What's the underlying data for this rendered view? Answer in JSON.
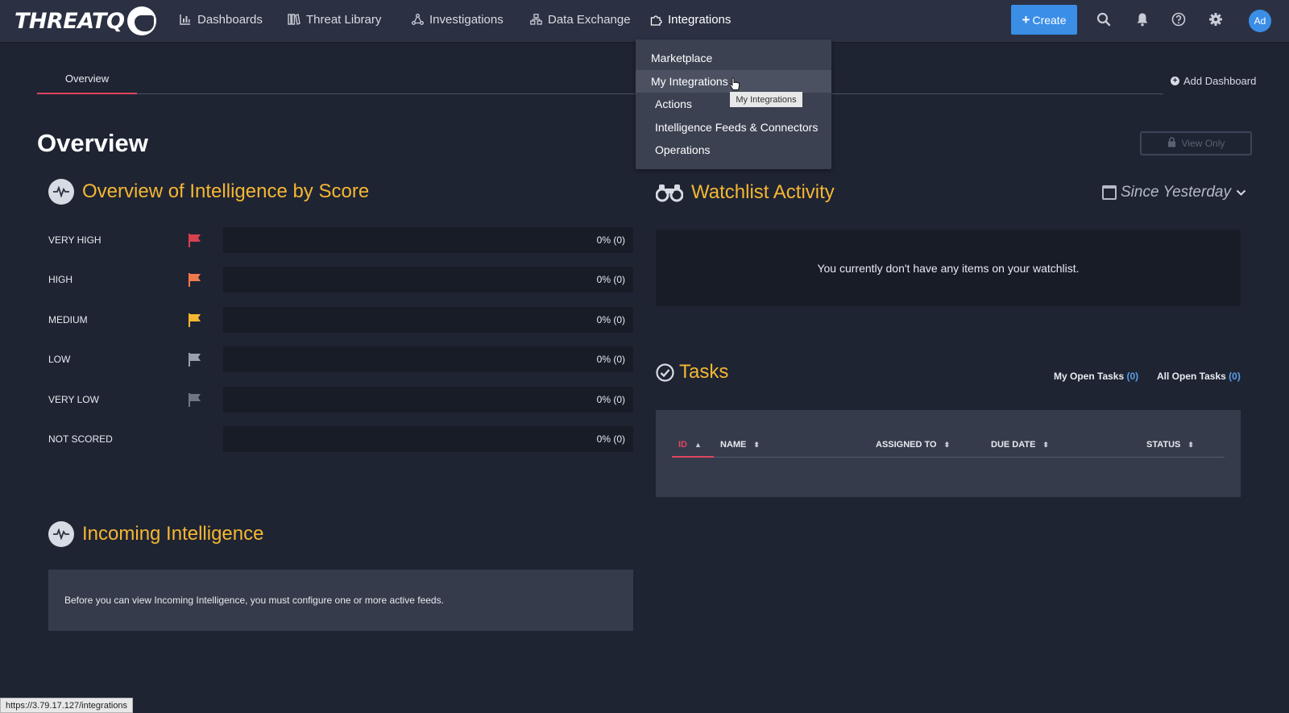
{
  "brand": {
    "logo_text": "THREATQ"
  },
  "nav": [
    {
      "label": "Dashboards",
      "icon": "bar-chart-icon"
    },
    {
      "label": "Threat Library",
      "icon": "library-icon"
    },
    {
      "label": "Investigations",
      "icon": "graph-icon"
    },
    {
      "label": "Data Exchange",
      "icon": "network-icon"
    },
    {
      "label": "Integrations",
      "icon": "puzzle-icon"
    }
  ],
  "topbar": {
    "create_label": "Create",
    "avatar_initials": "Ad"
  },
  "tabs": {
    "overview": "Overview",
    "add_dashboard": "Add Dashboard"
  },
  "page": {
    "title": "Overview",
    "view_only": "View Only"
  },
  "score_widget": {
    "title": "Overview of Intelligence by Score",
    "rows": [
      {
        "label": "VERY HIGH",
        "value": "0% (0)",
        "flag_color": "#d8404e",
        "percent": 0
      },
      {
        "label": "HIGH",
        "value": "0% (0)",
        "flag_color": "#f07a4c",
        "percent": 0
      },
      {
        "label": "MEDIUM",
        "value": "0% (0)",
        "flag_color": "#f5b731",
        "percent": 0
      },
      {
        "label": "LOW",
        "value": "0% (0)",
        "flag_color": "#9aa1ad",
        "percent": 0
      },
      {
        "label": "VERY LOW",
        "value": "0% (0)",
        "flag_color": "#6f7684",
        "percent": 0
      },
      {
        "label": "NOT SCORED",
        "value": "0% (0)",
        "flag_color": "",
        "percent": 0
      }
    ]
  },
  "watchlist": {
    "title": "Watchlist Activity",
    "range": "Since Yesterday",
    "empty_message": "You currently don't have any items on your watchlist."
  },
  "tasks": {
    "title": "Tasks",
    "my_open_label": "My Open Tasks",
    "my_open_count": "(0)",
    "all_open_label": "All Open Tasks",
    "all_open_count": "(0)",
    "columns": [
      "ID",
      "NAME",
      "ASSIGNED TO",
      "DUE DATE",
      "STATUS"
    ]
  },
  "incoming": {
    "title": "Incoming Intelligence",
    "message": "Before you can view Incoming Intelligence, you must configure one or more active feeds."
  },
  "integrations_menu": {
    "items": [
      "Marketplace",
      "My Integrations",
      "Actions",
      "Intelligence Feeds & Connectors",
      "Operations"
    ],
    "tooltip": "My Integrations"
  },
  "status_bar": {
    "url": "https://3.79.17.127/integrations"
  },
  "colors": {
    "accent": "#f5b731",
    "primary": "#3a8ee6",
    "danger": "#e0455e",
    "background": "#1f2433"
  }
}
